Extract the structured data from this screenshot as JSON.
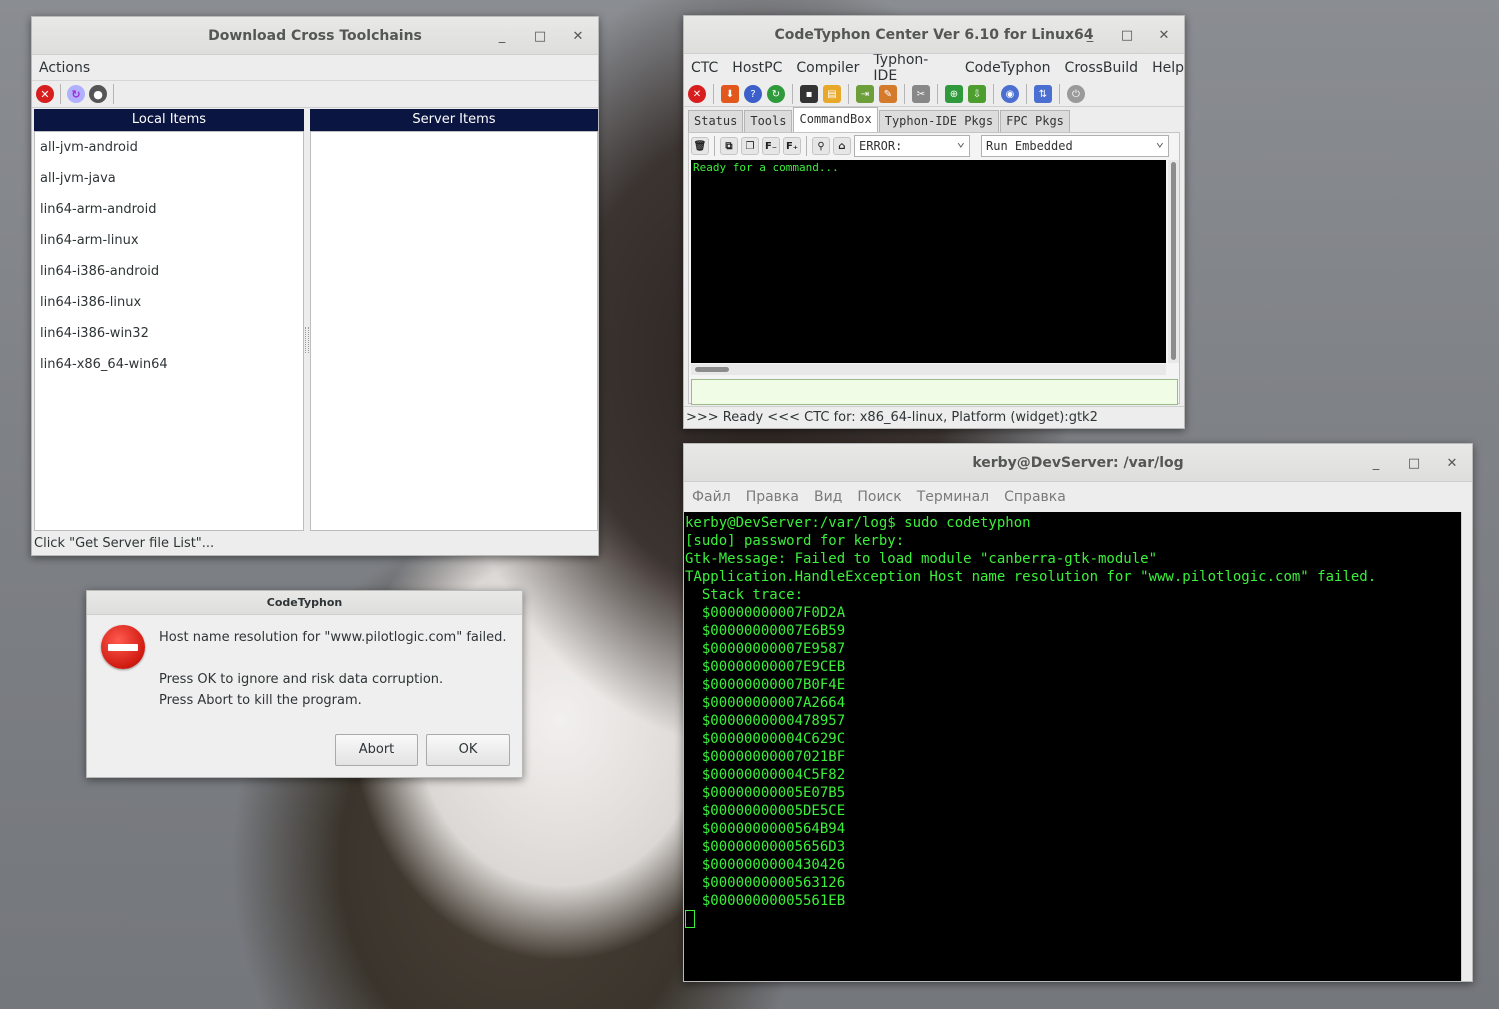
{
  "dl": {
    "title": "Download Cross Toolchains",
    "menu_actions": "Actions",
    "local_header": "Local Items",
    "server_header": "Server Items",
    "local_items": [
      "all-jvm-android",
      "all-jvm-java",
      "lin64-arm-android",
      "lin64-arm-linux",
      "lin64-i386-android",
      "lin64-i386-linux",
      "lin64-i386-win32",
      "lin64-x86_64-win64"
    ],
    "status": "Click \"Get Server file List\"..."
  },
  "ctc": {
    "title": "CodeTyphon Center Ver 6.10 for Linux64",
    "menu": [
      "CTC",
      "HostPC",
      "Compiler",
      "Typhon-IDE",
      "CodeTyphon",
      "CrossBuild",
      "Help"
    ],
    "tabs": [
      "Status",
      "Tools",
      "CommandBox",
      "Typhon-IDE Pkgs",
      "FPC Pkgs"
    ],
    "filter_value": "ERROR:",
    "run_mode": "Run Embedded",
    "console_text": "Ready for a command...",
    "status": ">>> Ready <<<  CTC for: x86_64-linux, Platform (widget):gtk2"
  },
  "term": {
    "title": "kerby@DevServer: /var/log",
    "menu": [
      "Файл",
      "Правка",
      "Вид",
      "Поиск",
      "Терминал",
      "Справка"
    ],
    "lines": [
      "kerby@DevServer:/var/log$ sudo codetyphon",
      "[sudo] password for kerby:",
      "Gtk-Message: Failed to load module \"canberra-gtk-module\"",
      "TApplication.HandleException Host name resolution for \"www.pilotlogic.com\" failed.",
      "  Stack trace:",
      "  $00000000007F0D2A",
      "  $00000000007E6B59",
      "  $00000000007E9587",
      "  $00000000007E9CEB",
      "  $00000000007B0F4E",
      "  $00000000007A2664",
      "  $0000000000478957",
      "  $00000000004C629C",
      "  $00000000007021BF",
      "  $00000000004C5F82",
      "  $00000000005E07B5",
      "  $00000000005DE5CE",
      "  $0000000000564B94",
      "  $00000000005656D3",
      "  $0000000000430426",
      "  $0000000000563126",
      "  $00000000005561EB"
    ]
  },
  "dlg": {
    "title": "CodeTyphon",
    "line1": "Host name resolution for \"www.pilotlogic.com\" failed.",
    "line2": "Press OK to ignore and risk data corruption.",
    "line3": "Press Abort to kill the program.",
    "abort": "Abort",
    "ok": "OK"
  },
  "icons": {
    "minimize": "_",
    "maximize": "□",
    "close": "✕"
  }
}
